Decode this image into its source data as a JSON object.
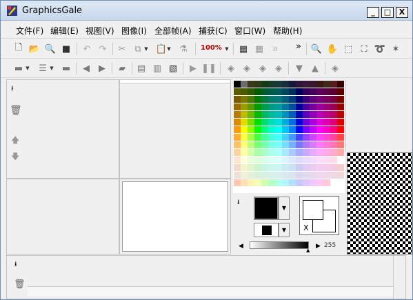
{
  "window": {
    "title": "GraphicsGale"
  },
  "title_buttons": {
    "minimize": "_",
    "maximize": "□",
    "close": "X"
  },
  "menu": [
    "文件(F)",
    "编辑(E)",
    "视图(V)",
    "图像(I)",
    "全部帧(A)",
    "捕获(C)",
    "窗口(W)",
    "帮助(H)"
  ],
  "toolbar1": {
    "zoom_value": "100%",
    "overflow": "»"
  },
  "color_panel": {
    "alpha_value": "255",
    "swap_label": "X"
  },
  "palette": {
    "rows": [
      [
        "#000000",
        "#6b6b6b",
        "#3a3a16",
        "#2c3a16",
        "#163a16",
        "#163a2c",
        "#163a3a",
        "#162c3a",
        "#16163a",
        "#2c163a",
        "#3a163a",
        "#3a162c",
        "#3a1616",
        "#3a2c16",
        "#5a1a1a",
        "#3a0000"
      ],
      [
        "#5a5a00",
        "#4a5a00",
        "#2d5a00",
        "#005a00",
        "#005a2d",
        "#005a4a",
        "#005a5a",
        "#00455a",
        "#002d5a",
        "#00005a",
        "#2d005a",
        "#45005a",
        "#5a005a",
        "#5a0045",
        "#5a002d",
        "#5a0000"
      ],
      [
        "#7a5a00",
        "#7a7a00",
        "#4a7a00",
        "#007a00",
        "#007a3c",
        "#007a6a",
        "#007a7a",
        "#00607a",
        "#003c7a",
        "#00007a",
        "#3c007a",
        "#60007a",
        "#7a007a",
        "#7a0060",
        "#7a003c",
        "#7a0000"
      ],
      [
        "#9b6a00",
        "#9b9b00",
        "#5a9b00",
        "#009b00",
        "#009b4d",
        "#009b85",
        "#009b9b",
        "#00789b",
        "#004d9b",
        "#00009b",
        "#4d009b",
        "#78009b",
        "#9b009b",
        "#9b0078",
        "#9b004d",
        "#9b0000"
      ],
      [
        "#bb7a00",
        "#bbbb00",
        "#6abb00",
        "#00bb00",
        "#00bb5d",
        "#00bba0",
        "#00bbbb",
        "#0090bb",
        "#005dbb",
        "#0000bb",
        "#5d00bb",
        "#9000bb",
        "#bb00bb",
        "#bb0090",
        "#bb005d",
        "#bb0000"
      ],
      [
        "#dd8a00",
        "#dddd00",
        "#7add00",
        "#00dd00",
        "#00dd6e",
        "#00ddbb",
        "#00dddd",
        "#00aadd",
        "#006edd",
        "#0000dd",
        "#6e00dd",
        "#aa00dd",
        "#dd00dd",
        "#dd00aa",
        "#dd006e",
        "#dd0000"
      ],
      [
        "#ff9a00",
        "#ffff00",
        "#8aff00",
        "#00ff00",
        "#00ff80",
        "#00ffd4",
        "#00ffff",
        "#00c4ff",
        "#0080ff",
        "#0000ff",
        "#8000ff",
        "#c400ff",
        "#ff00ff",
        "#ff00c4",
        "#ff0080",
        "#ff0000"
      ],
      [
        "#ffad33",
        "#ffff44",
        "#a5ff44",
        "#44ff44",
        "#44ff99",
        "#44ffdd",
        "#44ffff",
        "#44d0ff",
        "#4499ff",
        "#4444ff",
        "#9944ff",
        "#d044ff",
        "#ff44ff",
        "#ff44d0",
        "#ff4499",
        "#ff4444"
      ],
      [
        "#ffc066",
        "#ffff77",
        "#bbff77",
        "#77ff77",
        "#77ffb0",
        "#77ffe5",
        "#77ffff",
        "#77dcff",
        "#77b0ff",
        "#7777ff",
        "#b077ff",
        "#dc77ff",
        "#ff77ff",
        "#ff77dc",
        "#ff77b0",
        "#ff7777"
      ],
      [
        "#ffd399",
        "#ffffaa",
        "#d1ffaa",
        "#aaffaa",
        "#aaffc9",
        "#aaffee",
        "#aaffff",
        "#aae8ff",
        "#aac9ff",
        "#aaaaff",
        "#c9aaff",
        "#e8aaff",
        "#ffaaff",
        "#ffaae8",
        "#ffaac9",
        "#ffaaaa"
      ],
      [
        "#ffe6cc",
        "#ffffdd",
        "#e8ffdd",
        "#ddffdd",
        "#ddffe8",
        "#ddfff6",
        "#ddffff",
        "#ddf3ff",
        "#dde8ff",
        "#ddddff",
        "#e8ddff",
        "#f3ddff",
        "#ffddff",
        "#ffddf3",
        "#ffdde8",
        "#ffffff"
      ],
      [
        "#f4dccc",
        "#f4f4cc",
        "#e2f4cc",
        "#ccf4cc",
        "#ccf4e2",
        "#ccf4f0",
        "#ccf4f4",
        "#ccecf4",
        "#cce2f4",
        "#ccccf4",
        "#e2ccf4",
        "#ecccf4",
        "#f4ccf4",
        "#f4ccec",
        "#f4cce2",
        "#f4cccc"
      ],
      [
        "#f0e0d8",
        "#f0f0d8",
        "#e4f0d8",
        "#d8f0d8",
        "#d8f0e4",
        "#d8f0ec",
        "#d8f0f0",
        "#d8eaf0",
        "#d8e4f0",
        "#d8d8f0",
        "#e4d8f0",
        "#ead8f0",
        "#f0d8f0",
        "#f0d8ea",
        "#f0d8e4",
        "#f0d8d8"
      ],
      [
        "#ffc8b4",
        "#ffe0b4",
        "#fff0b4",
        "#f0ffb4",
        "#d0ffb4",
        "#b4ffc8",
        "#b4ffe8",
        "#b4f4ff",
        "#b4e0ff",
        "#c8c8ff",
        "#dcc8ff",
        "#f0c8ff",
        "#ffc8f0",
        "#ffc8dc",
        "#ffffff",
        "#ffffff"
      ]
    ]
  }
}
